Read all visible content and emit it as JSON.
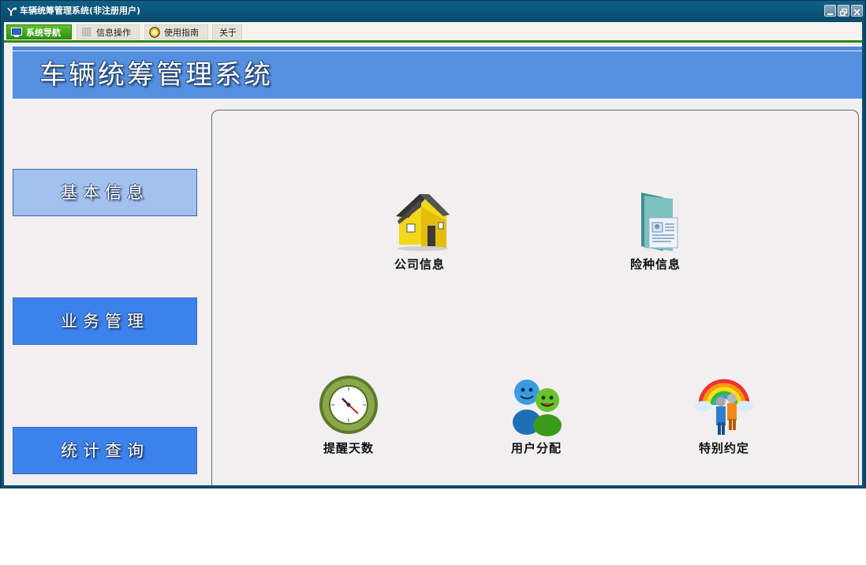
{
  "window": {
    "title": "车辆统筹管理系统(非注册用户)"
  },
  "tabs": [
    {
      "label": "系统导航",
      "active": true,
      "icon": "monitor-icon"
    },
    {
      "label": "信息操作",
      "active": false,
      "icon": "grid-icon"
    },
    {
      "label": "使用指南",
      "active": false,
      "icon": "guide-icon"
    },
    {
      "label": "关于",
      "active": false,
      "icon": ""
    }
  ],
  "banner": {
    "title": "车辆统筹管理系统"
  },
  "sidebar": {
    "items": [
      {
        "label": "基本信息",
        "state": "selected"
      },
      {
        "label": "业务管理",
        "state": "normal"
      },
      {
        "label": "统计查询",
        "state": "normal"
      }
    ]
  },
  "tiles": [
    {
      "label": "公司信息",
      "icon": "house-icon"
    },
    {
      "label": "险种信息",
      "icon": "document-folder-icon"
    },
    {
      "label": "提醒天数",
      "icon": "clock-icon"
    },
    {
      "label": "用户分配",
      "icon": "users-icon"
    },
    {
      "label": "特别约定",
      "icon": "rainbow-people-icon"
    }
  ],
  "colors": {
    "titlebar": "#0a4f72",
    "tab_active": "#3fa61b",
    "banner": "#5590e0",
    "sidebar_selected": "#a3c1ee",
    "sidebar_normal": "#3b82ed"
  }
}
